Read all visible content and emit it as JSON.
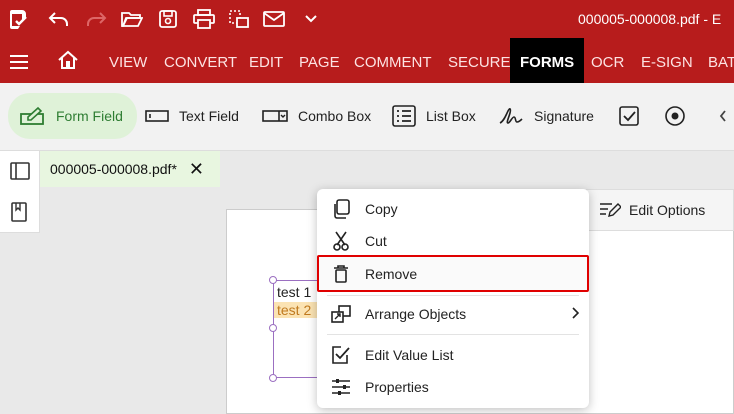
{
  "titlebar": {
    "doc_title": "000005-000008.pdf  -  E",
    "icons": [
      "app-logo-icon",
      "undo-icon",
      "redo-icon",
      "open-folder-icon",
      "save-icon",
      "print-icon",
      "scan-icon",
      "email-icon",
      "chevron-down-icon"
    ]
  },
  "menubar": {
    "items": [
      "VIEW",
      "CONVERT",
      "EDIT",
      "PAGE",
      "COMMENT",
      "SECURE",
      "FORMS",
      "OCR",
      "E-SIGN",
      "BAT"
    ],
    "active": "FORMS"
  },
  "ribbon": {
    "form_field": "Form Field",
    "text_field": "Text Field",
    "combo_box": "Combo Box",
    "list_box": "List Box",
    "signature": "Signature"
  },
  "tab": {
    "label": "000005-000008.pdf*"
  },
  "field": {
    "line1": "test 1",
    "line2": "test 2"
  },
  "edit_options": {
    "label": "Edit Options"
  },
  "context_menu": {
    "copy": "Copy",
    "cut": "Cut",
    "remove": "Remove",
    "arrange": "Arrange Objects",
    "edit_value_list": "Edit Value List",
    "properties": "Properties"
  },
  "colors": {
    "brand": "#b71c1c",
    "active_tab": "#000000",
    "selected": "#dff2d8",
    "highlight": "#e00000"
  }
}
